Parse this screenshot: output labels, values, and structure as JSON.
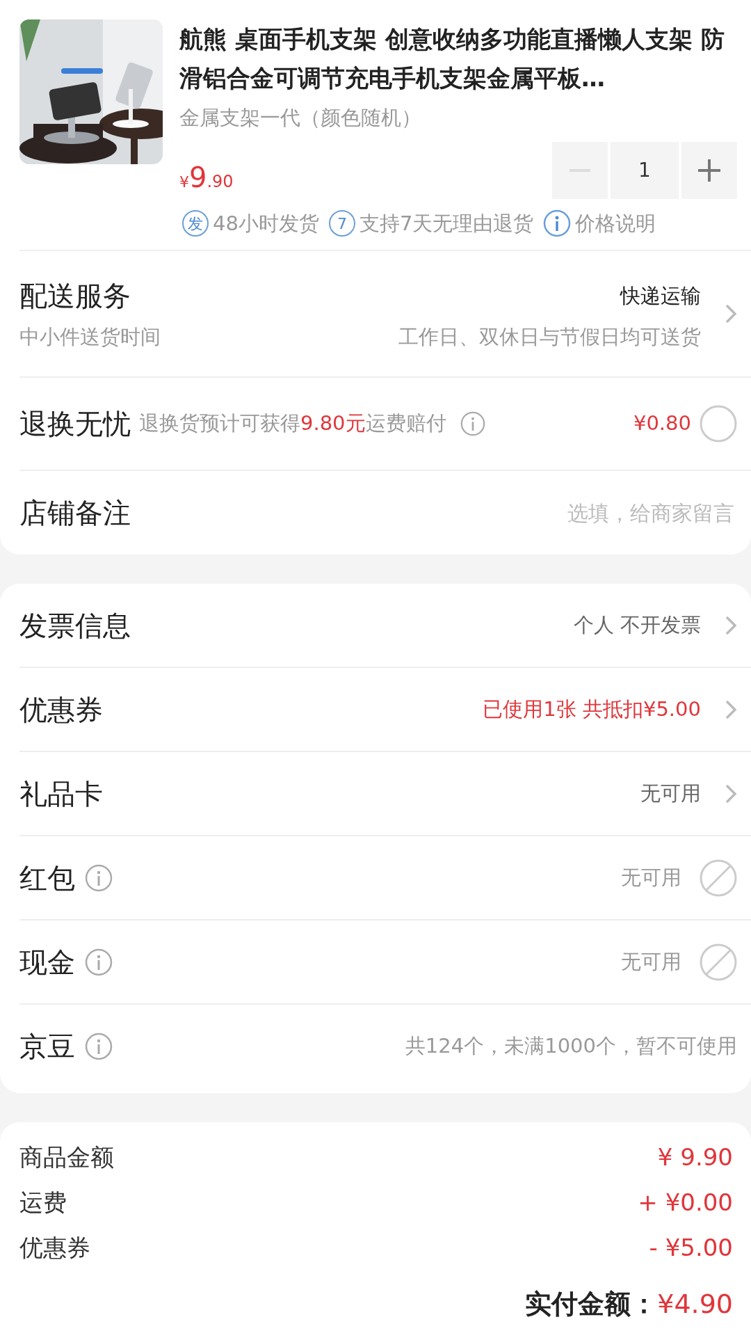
{
  "product": {
    "kind": "picture",
    "title": "航熊 桌面手机支架 创意收纳多功能直播懒人支架 防滑铝合金可调节充电手机支架金属平板…",
    "variant": "金属支架一代（颜色随机）",
    "price": {
      "symbol": "¥",
      "integer": "9",
      "decimal": ".90"
    },
    "quantity": "1",
    "minus_disabled": true,
    "services": [
      {
        "kind": "badge",
        "badge": "发",
        "text": "48小时发货"
      },
      {
        "kind": "badge",
        "badge": "7",
        "text": "支持7天无理由退货"
      },
      {
        "kind": "info",
        "text": "价格说明"
      }
    ]
  },
  "delivery": {
    "label": "配送服务",
    "sublabel": "中小件送货时间",
    "value": "快递运输",
    "subvalue": "工作日、双休日与节假日均可送货"
  },
  "return_insurance": {
    "label": "退换无忧",
    "note": "退换货预计可获得**9.80元**运费赔付",
    "price": "¥0.80",
    "checked": false
  },
  "store_note": {
    "label": "店铺备注",
    "placeholder": "选填，给商家留言"
  },
  "payment_rows": [
    {
      "label": "发票信息",
      "info": false,
      "value": "个人 不开发票",
      "highlight": false,
      "kind": "link"
    },
    {
      "label": "优惠券",
      "info": false,
      "value": "已使用1张 共抵扣¥5.00",
      "highlight": true,
      "kind": "link"
    },
    {
      "label": "礼品卡",
      "info": false,
      "value": "无可用",
      "highlight": false,
      "kind": "link"
    },
    {
      "label": "红包",
      "info": true,
      "value": "无可用",
      "highlight": false,
      "kind": "disabled"
    },
    {
      "label": "现金",
      "info": true,
      "value": "无可用",
      "highlight": false,
      "kind": "disabled"
    },
    {
      "label": "京豆",
      "info": true,
      "value": "共124个，未满1000个，暂不可使用",
      "highlight": false,
      "kind": "text"
    }
  ],
  "summary": [
    {
      "label": "商品金额",
      "amount": "¥ 9.90"
    },
    {
      "label": "运费",
      "amount": "+ ¥0.00"
    },
    {
      "label": "优惠券",
      "amount": "- ¥5.00"
    }
  ],
  "total": {
    "label": "实付金额：",
    "amount": "¥4.90"
  }
}
